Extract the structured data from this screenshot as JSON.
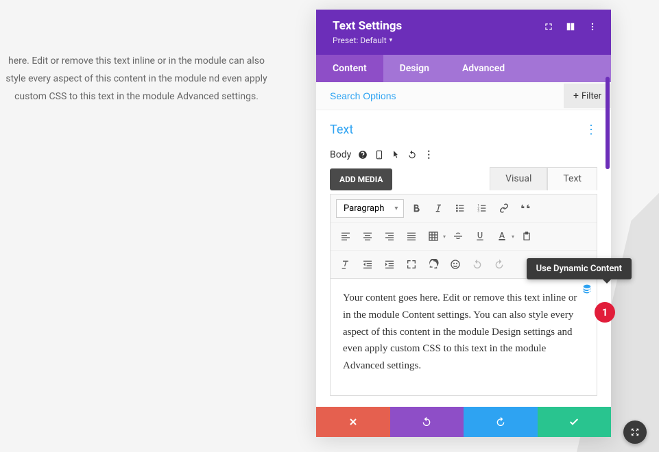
{
  "background_text": "here. Edit or remove this text inline or in the module can also style every aspect of this content in the module nd even apply custom CSS to this text in the module Advanced settings.",
  "modal": {
    "title": "Text Settings",
    "preset": "Preset: Default",
    "tabs": {
      "content": "Content",
      "design": "Design",
      "advanced": "Advanced"
    },
    "search_placeholder": "Search Options",
    "filter_label": "Filter",
    "section_title": "Text",
    "field_label": "Body",
    "add_media": "ADD MEDIA",
    "editor_tabs": {
      "visual": "Visual",
      "text": "Text"
    },
    "paragraph_select": "Paragraph",
    "editor_text": "Your content goes here. Edit or remove this text inline or in the module Content settings. You can also style every aspect of this content in the module Design settings and even apply custom CSS to this text in the module Advanced settings.",
    "tooltip": "Use Dynamic Content",
    "badge": "1"
  }
}
